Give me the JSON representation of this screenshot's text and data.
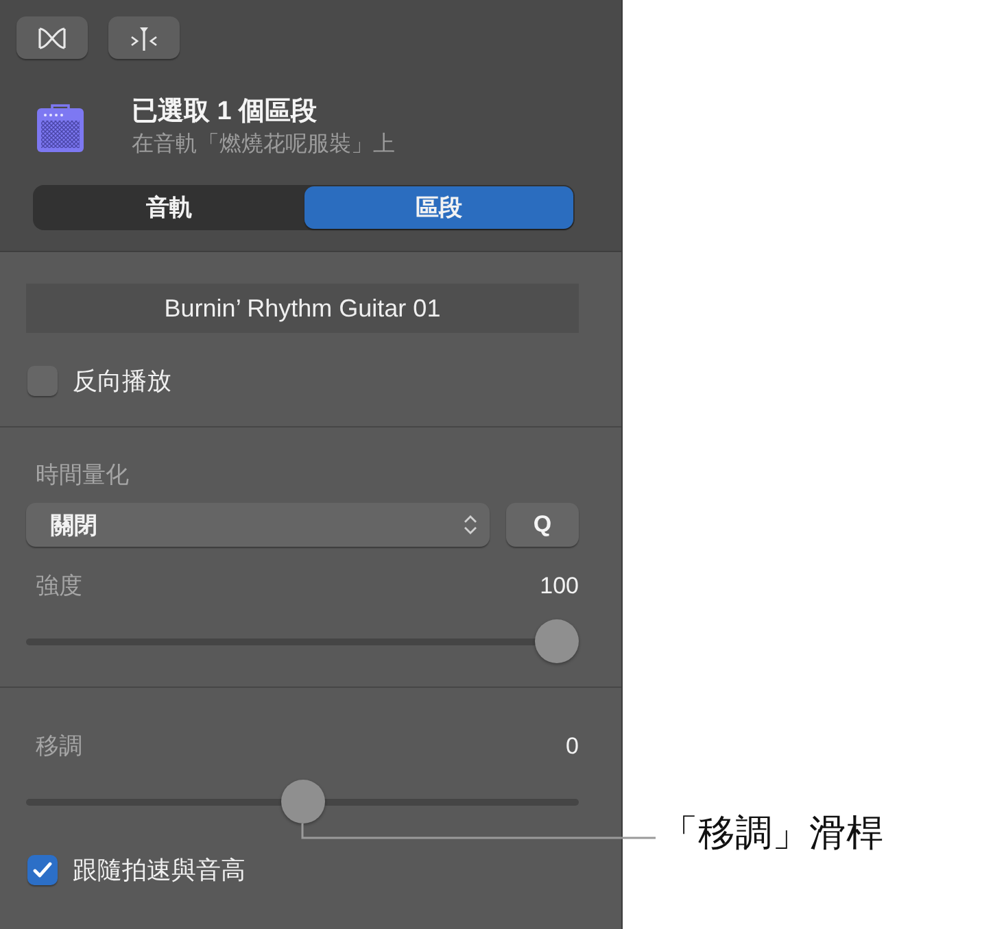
{
  "header": {
    "title": "已選取 1 個區段",
    "subtitle": "在音軌「燃燒花呢服裝」上"
  },
  "tabs": [
    {
      "label": "音軌",
      "selected": false
    },
    {
      "label": "區段",
      "selected": true
    }
  ],
  "region_name": {
    "value": "Burnin’ Rhythm Guitar 01"
  },
  "reverse_playback": {
    "label": "反向播放",
    "checked": false
  },
  "time_quantize": {
    "label": "時間量化",
    "value": "關閉",
    "button": "Q"
  },
  "strength": {
    "label": "強度",
    "reading": "100",
    "level": 1
  },
  "transpose": {
    "label": "移調",
    "reading": "0",
    "level": 0.5
  },
  "follow_tempo": {
    "label": "跟隨拍速與音高",
    "checked": true
  },
  "callout": {
    "text": "「移調」滑桿"
  }
}
